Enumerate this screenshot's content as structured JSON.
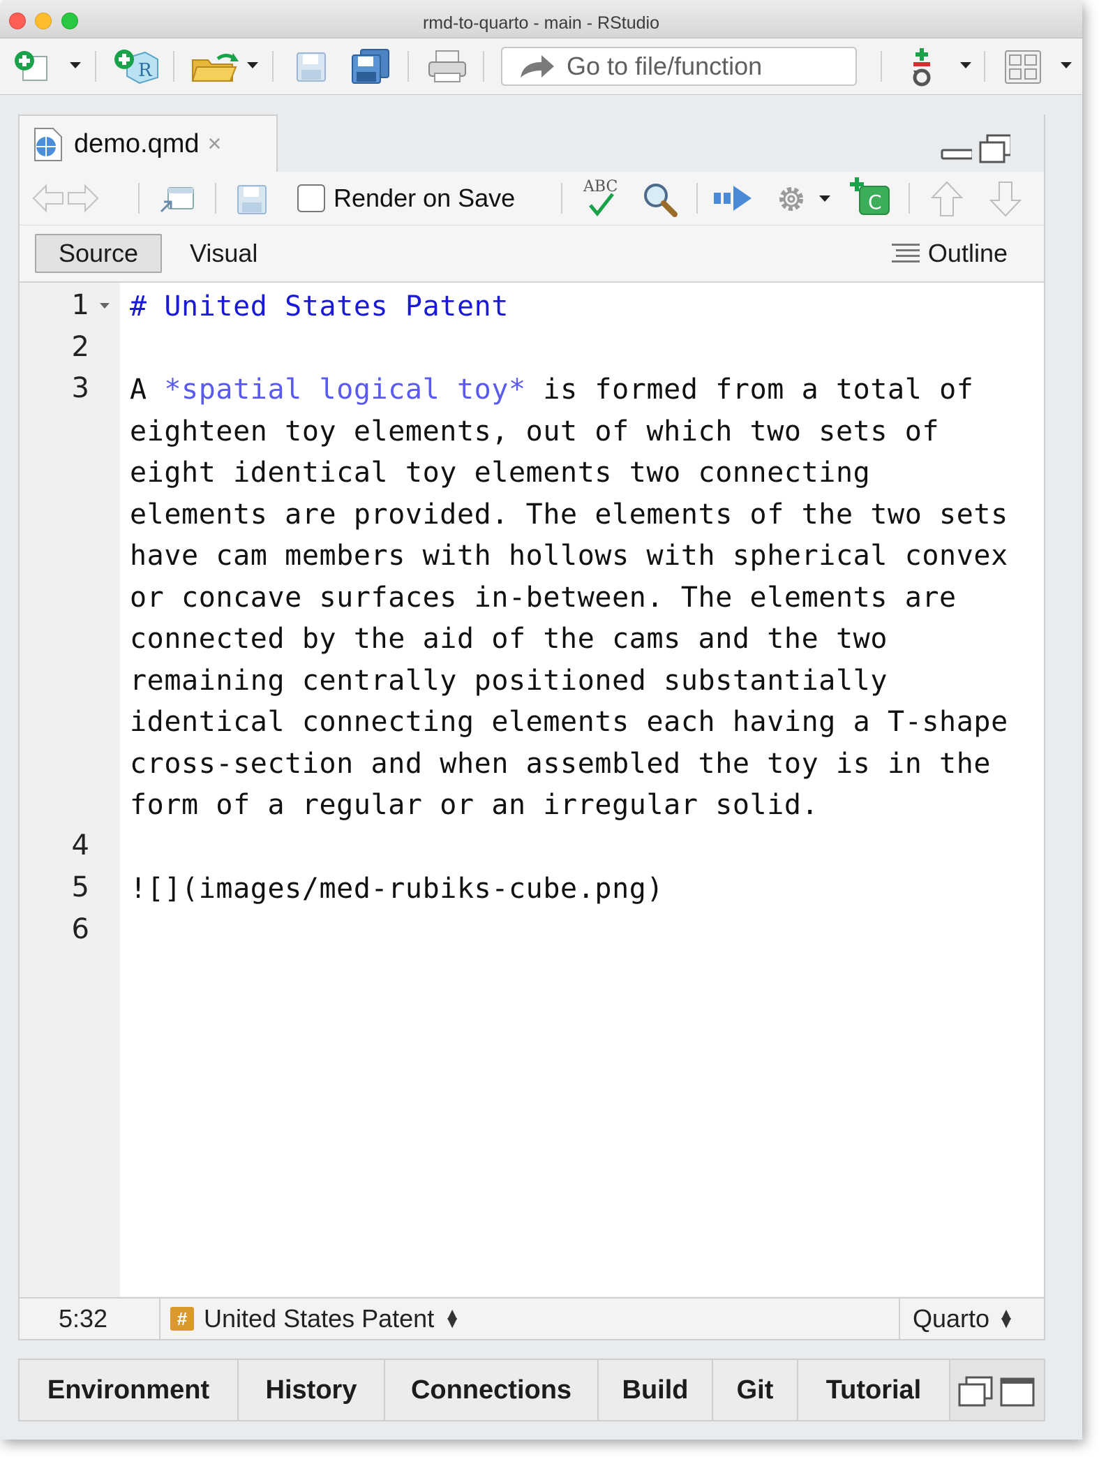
{
  "window": {
    "title": "rmd-to-quarto - main - RStudio"
  },
  "toolbar": {
    "goto_placeholder": "Go to file/function"
  },
  "editor": {
    "tab_name": "demo.qmd",
    "tab_close": "×",
    "render_on_save_label": "Render on Save",
    "render_on_save_checked": false,
    "source_label": "Source",
    "visual_label": "Visual",
    "outline_label": "Outline",
    "line_numbers": [
      "1",
      "2",
      "3",
      "4",
      "5",
      "6"
    ],
    "code": {
      "line1": "# United States Patent",
      "line3_prefix": "A ",
      "line3_emph": "*spatial logical toy*",
      "line3_rest": " is formed from a total of",
      "wrapped": [
        "eighteen toy elements, out of which two sets of",
        "eight identical toy elements two connecting",
        "elements are provided. The elements of the two sets",
        "have cam members with hollows with spherical convex",
        "or concave surfaces in-between. The elements are",
        "connected by the aid of the cams and the two",
        "remaining centrally positioned substantially",
        "identical connecting elements each having a T-shape",
        "cross-section and when assembled the toy is in the",
        "form of a regular or an irregular solid."
      ],
      "line5": "![](images/med-rubiks-cube.png)"
    }
  },
  "statusbar": {
    "cursor_position": "5:32",
    "section_badge": "#",
    "section": "United States Patent",
    "doc_type": "Quarto"
  },
  "bottom_tabs": [
    "Environment",
    "History",
    "Connections",
    "Build",
    "Git",
    "Tutorial"
  ],
  "colors": {
    "heading": "#1a1ad6",
    "emphasis": "#5a5af0",
    "section_badge": "#d99a2b"
  }
}
